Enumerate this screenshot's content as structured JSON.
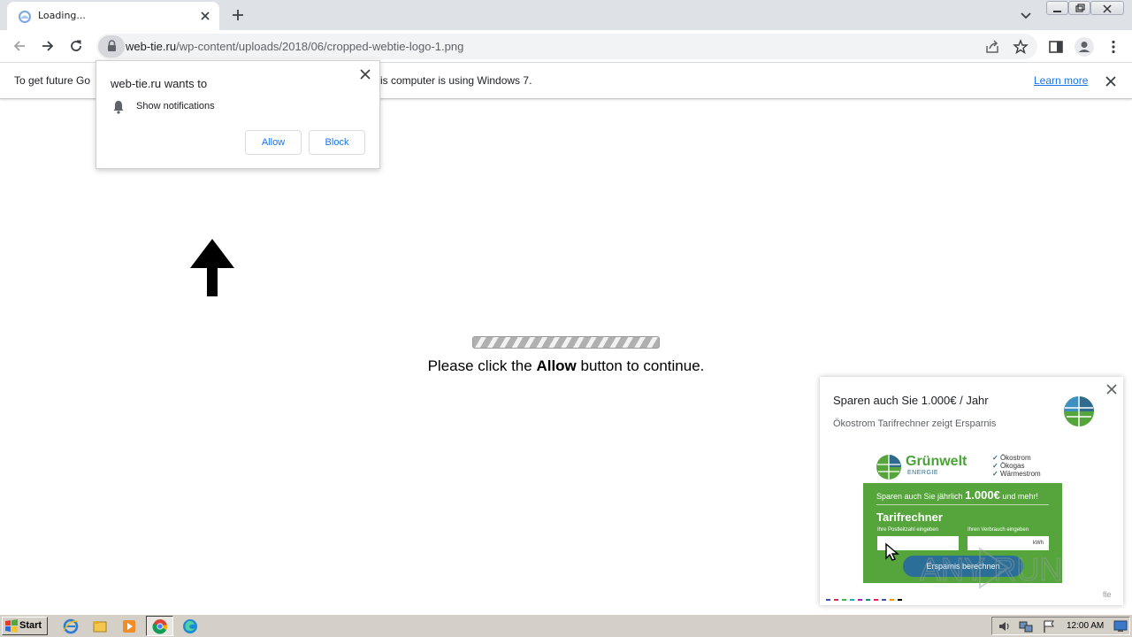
{
  "browser": {
    "tab_title": "Loading...",
    "url_host": "web-tie.ru",
    "url_path": "/wp-content/uploads/2018/06/cropped-webtie-logo-1.png"
  },
  "infobar": {
    "text_left": "To get future Go",
    "text_right": "is computer is using Windows 7.",
    "learn_more": "Learn more"
  },
  "permission_popup": {
    "title": "web-tie.ru wants to",
    "item": "Show notifications",
    "allow_label": "Allow",
    "block_label": "Block"
  },
  "page": {
    "progress_percent": 100,
    "message_before": "Please click the ",
    "message_bold": "Allow",
    "message_after": " button to continue."
  },
  "ad": {
    "title": "Sparen auch Sie 1.000€ / Jahr",
    "subtitle": "Ökostrom Tarifrechner zeigt Ersparnis",
    "brand": "Grünwelt",
    "brand_sub": "ENERGIE",
    "features": [
      "Ökostrom",
      "Ökogas",
      "Wärmestrom"
    ],
    "headline_prefix": "Sparen auch Sie jährlich ",
    "headline_amount": "1.000€",
    "headline_suffix": " und mehr!",
    "calculator_title": "Tarifrechner",
    "field1_label": "Ihre Postleitzahl eingeben",
    "field2_label": "Ihren Verbrauch eingeben",
    "field2_unit": "kWh",
    "cta_label": "Ersparnis berechnen",
    "sponsor": "fle",
    "watermark": "ANY RUN"
  },
  "taskbar": {
    "start_label": "Start",
    "clock": "12:00 AM"
  },
  "colors": {
    "accent_blue": "#1a73e8",
    "ad_green": "#56a53c",
    "ad_cta": "#2b6f99"
  }
}
